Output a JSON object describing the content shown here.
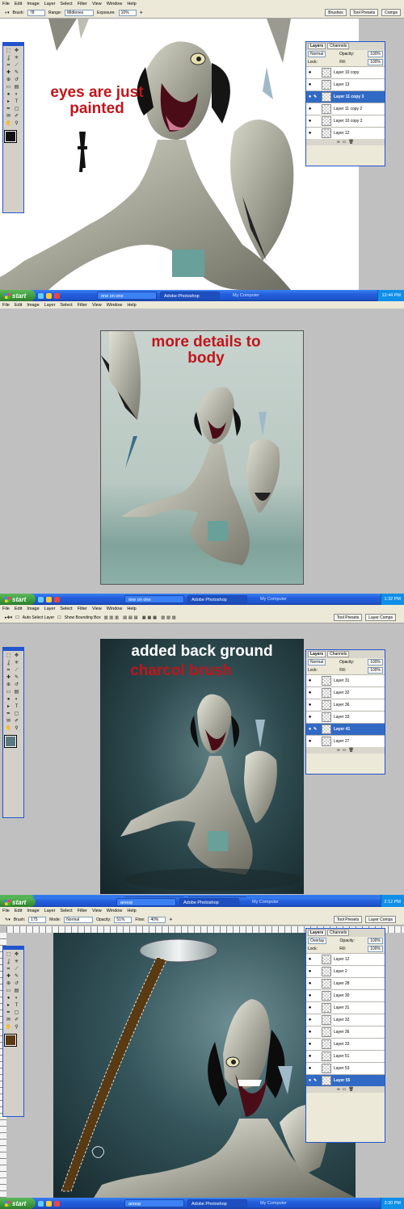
{
  "menu": [
    "File",
    "Edit",
    "Image",
    "Layer",
    "Select",
    "Filter",
    "View",
    "Window",
    "Help"
  ],
  "panel1": {
    "options": {
      "brush_label": "Brush:",
      "brush_size": "78",
      "range_label": "Range:",
      "range_value": "Midtones",
      "exposure_label": "Exposure:",
      "exposure_value": "10%"
    },
    "palette_tabs": [
      "Brushes",
      "Tool Presets",
      "Comps"
    ],
    "caption": "eyes are just painted",
    "layers": {
      "tabs": [
        "Layers",
        "Channels"
      ],
      "blend": "Normal",
      "opacity_label": "Opacity:",
      "opacity": "100%",
      "lock_label": "Lock:",
      "fill_label": "Fill:",
      "fill": "100%",
      "rows": [
        "Layer 10 copy",
        "Layer 13",
        "Layer 11 copy 3",
        "Layer 11 copy 2",
        "Layer 10 copy 2",
        "Layer 12"
      ],
      "selected": 2
    },
    "taskbar": {
      "start": "start",
      "items": [
        "one on one",
        "Adobe Photoshop"
      ],
      "mycomputer": "My Computer",
      "clock": "12:44 PM"
    }
  },
  "panel2": {
    "caption": "more details to body",
    "taskbar": {
      "start": "start",
      "items": [
        "one on one",
        "Adobe Photoshop"
      ],
      "mycomputer": "My Computer",
      "clock": "1:32 PM"
    }
  },
  "panel3": {
    "options": {
      "auto_select": "Auto Select Layer",
      "bounding_box": "Show Bounding Box"
    },
    "palette_tabs": [
      "Tool Presets",
      "Layer Comps"
    ],
    "caption_line1": "added back ground",
    "caption_line2": "charcol brush",
    "layers": {
      "tabs": [
        "Layers",
        "Channels"
      ],
      "blend": "Normal",
      "opacity_label": "Opacity:",
      "opacity": "100%",
      "lock_label": "Lock:",
      "fill_label": "Fill:",
      "fill": "100%",
      "rows": [
        "Layer 31",
        "Layer 32",
        "Layer 36",
        "Layer 33",
        "Layer 41",
        "Layer 27"
      ],
      "selected": 4
    },
    "taskbar": {
      "start": "start",
      "items": [
        "anoop",
        "Adobe Photoshop"
      ],
      "mycomputer": "My Computer",
      "clock": "2:12 PM"
    }
  },
  "panel4": {
    "options": {
      "brush_label": "Brush:",
      "brush_size": "175",
      "mode_label": "Mode:",
      "mode_value": "Normal",
      "opacity_label": "Opacity:",
      "opacity_value": "51%",
      "flow_label": "Flow:",
      "flow_value": "40%"
    },
    "palette_tabs": [
      "Tool Presets",
      "Layer Comps"
    ],
    "layers": {
      "tabs": [
        "Layers",
        "Channels"
      ],
      "blend": "Overlay",
      "opacity_label": "Opacity:",
      "opacity": "100%",
      "lock_label": "Lock:",
      "fill_label": "Fill:",
      "fill": "100%",
      "rows": [
        "Layer 12",
        "Layer 2",
        "Layer 28",
        "Layer 30",
        "Layer 31",
        "Layer 32",
        "Layer 36",
        "Layer 33",
        "Layer 51",
        "Layer 53",
        "Layer 55"
      ],
      "selected": 10
    },
    "taskbar": {
      "start": "start",
      "items": [
        "anoop",
        "Adobe Photoshop"
      ],
      "mycomputer": "My Computer",
      "clock": "3:30 PM"
    }
  },
  "colors": {
    "caption_red": "#c0151b",
    "selection_blue": "#316ac5",
    "bg_teal_dark": "#1d2f33",
    "bg_teal_light": "#c8d3ce"
  },
  "tools": [
    "marquee-icon",
    "move-icon",
    "lasso-icon",
    "magic-wand-icon",
    "crop-icon",
    "slice-icon",
    "healing-icon",
    "brush-icon",
    "stamp-icon",
    "history-brush-icon",
    "eraser-icon",
    "gradient-icon",
    "blur-icon",
    "dodge-icon",
    "path-select-icon",
    "type-icon",
    "pen-icon",
    "shape-icon",
    "notes-icon",
    "eyedropper-icon",
    "hand-icon",
    "zoom-icon"
  ],
  "tool_glyphs": [
    "⬚",
    "✥",
    "ʆ",
    "✳",
    "⌗",
    "⟋",
    "✚",
    "✎",
    "⊕",
    "↺",
    "▭",
    "▤",
    "●",
    "◐",
    "▸",
    "T",
    "✒",
    "▢",
    "✉",
    "✐",
    "✋",
    "⚲"
  ]
}
